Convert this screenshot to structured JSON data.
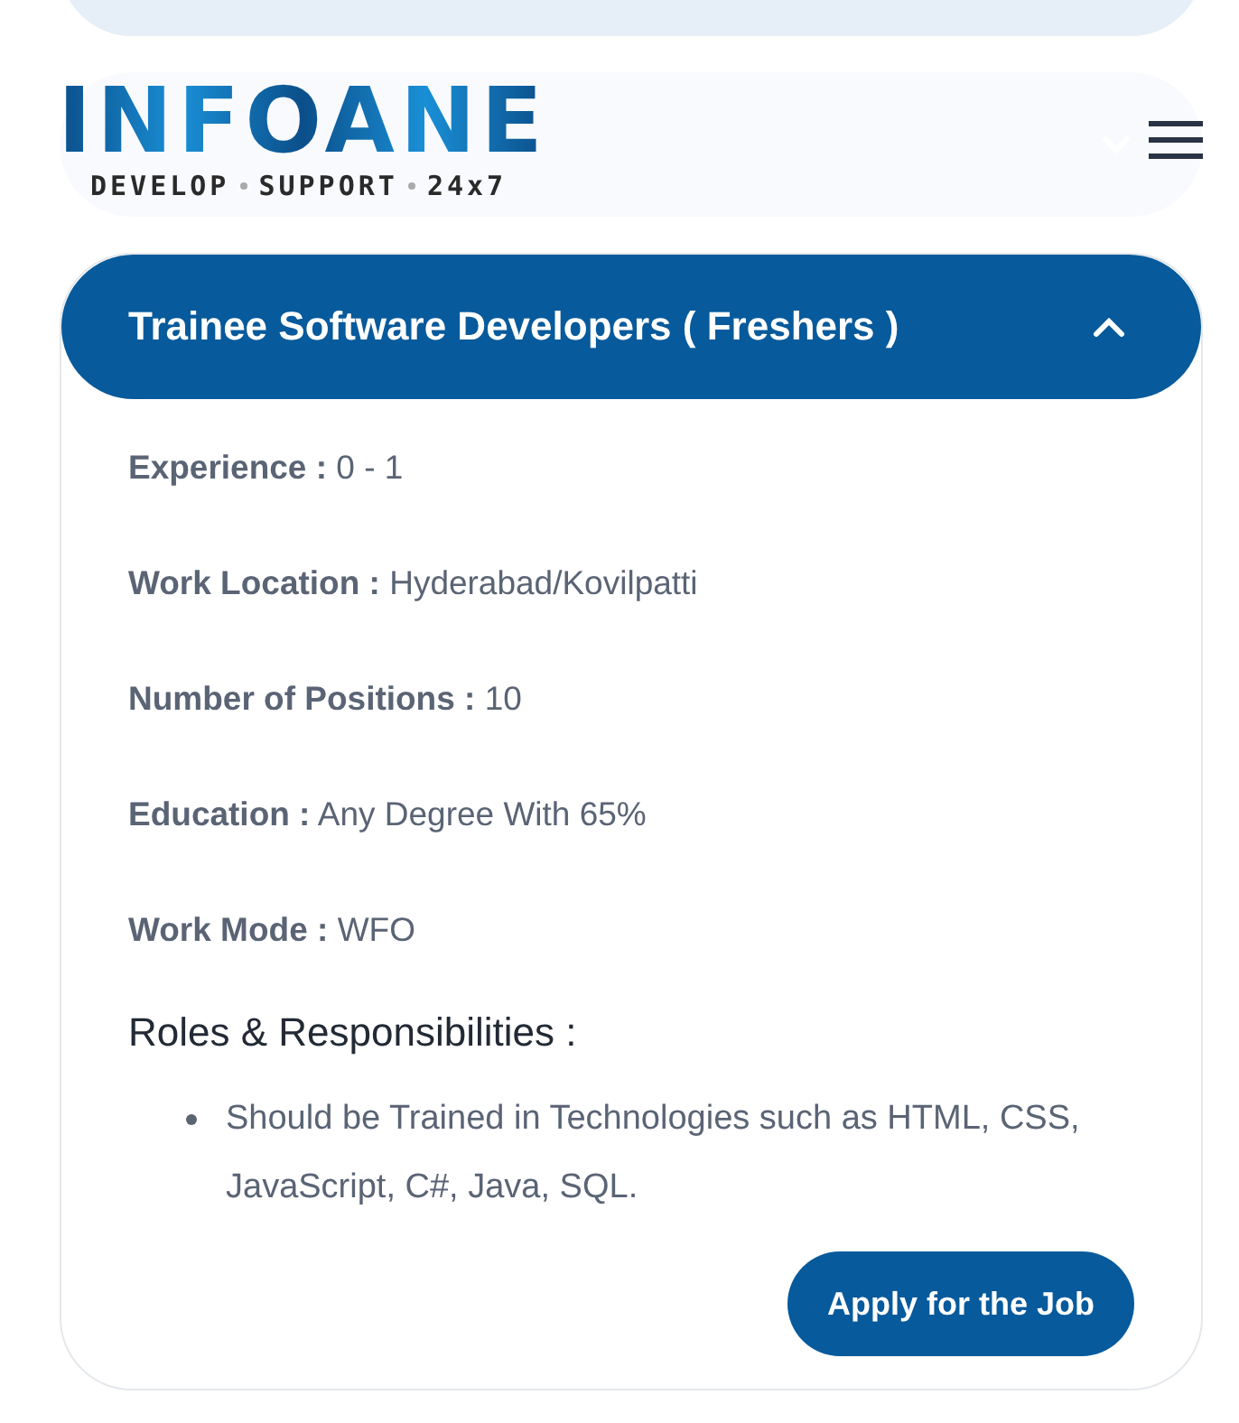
{
  "header": {
    "logo": "INFOANE",
    "tagline": [
      "DEVELOP",
      "SUPPORT",
      "24x7"
    ]
  },
  "jobs": [
    {
      "expanded": false,
      "kind": "edge"
    },
    {
      "expanded": false,
      "kind": "card"
    },
    {
      "expanded": true,
      "title": "Trainee Software Developers ( Freshers )",
      "details": [
        {
          "label": "Experience :",
          "value": "0 - 1"
        },
        {
          "label": "Work Location :",
          "value": "Hyderabad/Kovilpatti"
        },
        {
          "label": "Number of Positions :",
          "value": "10"
        },
        {
          "label": "Education :",
          "value": "Any Degree With 65%"
        },
        {
          "label": "Work Mode :",
          "value": "WFO"
        }
      ],
      "roles_heading": "Roles & Responsibilities :",
      "roles": [
        "Should be Trained in Technologies such as HTML, CSS, JavaScript, C#, Java, SQL."
      ],
      "apply": "Apply for the Job"
    }
  ]
}
